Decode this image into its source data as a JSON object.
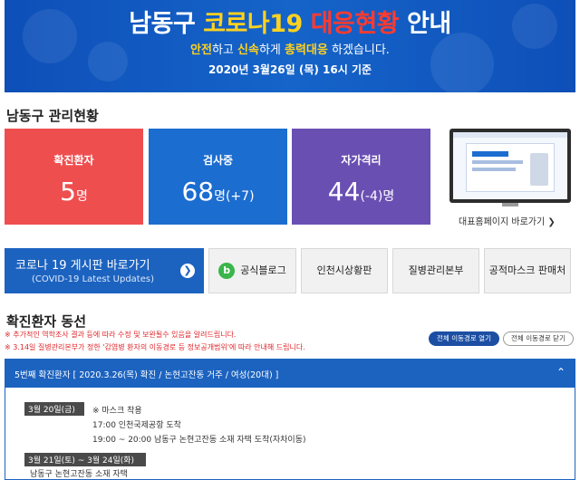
{
  "banner": {
    "title_pre": "남동구 ",
    "title_yellow": "코로나19 ",
    "title_red": "대응현황",
    "title_post": " 안내",
    "sub_y1": "안전",
    "sub_t1": "하고 ",
    "sub_y2": "신속",
    "sub_t2": "하게 ",
    "sub_y3": "총력대응",
    "sub_t3": " 하겠습니다.",
    "date": "2020년 3월26일 (목) 16시 기준"
  },
  "management": {
    "heading": "남동구 관리현황",
    "confirmed": {
      "label": "확진환자",
      "value": "5",
      "unit": "명"
    },
    "testing": {
      "label": "검사중",
      "value": "68",
      "unit": "명(+7)"
    },
    "quarantine": {
      "label": "자가격리",
      "value": "44",
      "unit": "(-4)명"
    },
    "home_link": "대표홈페이지 바로가기 ❯"
  },
  "links": {
    "board_title": "코로나 19 게시판 바로가기",
    "board_sub": "(COVID-19 Latest Updates)",
    "blog": "공식블로그",
    "blog_icon_letter": "b",
    "incheon": "인천시상황판",
    "kdca": "질병관리본부",
    "mask": "공적마스크 판매처"
  },
  "route": {
    "heading": "확진환자 동선",
    "notice1": "※ 추가적인 역학조사 결과 등에 따라 수정 및 보완될수 있음을 알려드립니다.",
    "notice2": "※ 3.14일 질병관리본부가 정한 '감염병 환자의 이동경로 등 정보공개범위'에 따라 안내해 드립니다.",
    "open_all": "전체 이동경로 열기",
    "close_all": "전체 이동경로 닫기",
    "panel_title": "5번째 확진환자 [ 2020.3.26(목) 확진 / 논현고잔동 거주 / 여성(20대) ]",
    "date1": "3월 20일(금)",
    "line1": "※ 마스크 착용",
    "line2": "17:00 인천국제공항 도착",
    "line3": "19:00 ~ 20:00 남동구 논현고잔동 소재 자택 도착(자차이동)",
    "date2": "3월 21일(토) ~ 3월 24일(화)",
    "line4": "남동구 논현고잔동 소재 자택"
  },
  "colors": {
    "banner_blue": "#1564c9",
    "confirmed_red": "#ef4e4f",
    "testing_blue": "#1c6dd0",
    "quarantine_purple": "#6a4fb3",
    "notice_red": "#e0262b"
  }
}
